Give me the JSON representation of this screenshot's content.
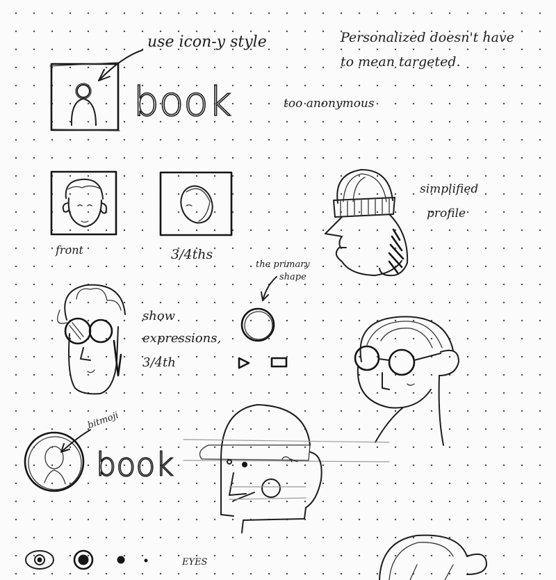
{
  "notes": {
    "use_icon_style": "use icon-y style",
    "personalized": "Personalized doesn't have",
    "personalized_2": "to mean targeted.",
    "too_anonymous": "too anonymous",
    "simplified": "simplified",
    "profile": "profile",
    "front": "front",
    "three_quarters": "3/4ths",
    "the_primary": "the primary",
    "shape": "shape",
    "show": "show",
    "expressions": "expressions,",
    "three_quarter": "3/4th",
    "bitmoji": "bitmoji",
    "eyes": "EYES"
  },
  "logos": {
    "book_1": "book",
    "book_2": "book"
  }
}
